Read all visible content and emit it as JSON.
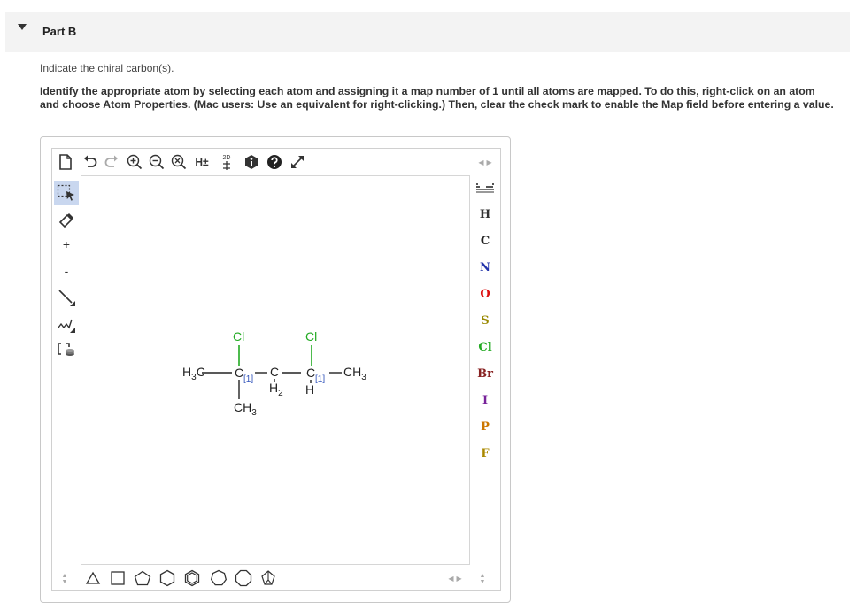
{
  "part": {
    "title": "Part B"
  },
  "question": {
    "prompt": "Indicate the chiral carbon(s).",
    "instructions": "Identify the appropriate atom by selecting each atom and assigning it a map number of 1 until all atoms are mapped. To do this, right-click on an atom and choose Atom Properties. (Mac users: Use an equivalent for right-clicking.) Then, clear the check mark to enable the Map field before entering a value."
  },
  "toolbar_top": {
    "hydrogen_toggle": "H±",
    "dimension_label": "2D"
  },
  "toolbar_left": {
    "charge_plus": "+",
    "charge_minus": "-"
  },
  "elements": [
    {
      "symbol": "H",
      "color": "#333333"
    },
    {
      "symbol": "C",
      "color": "#222222"
    },
    {
      "symbol": "N",
      "color": "#2233aa"
    },
    {
      "symbol": "O",
      "color": "#dd1111"
    },
    {
      "symbol": "S",
      "color": "#998800"
    },
    {
      "symbol": "Cl",
      "color": "#22aa22"
    },
    {
      "symbol": "Br",
      "color": "#882222"
    },
    {
      "symbol": "I",
      "color": "#772299"
    },
    {
      "symbol": "P",
      "color": "#cc7700"
    },
    {
      "symbol": "F",
      "color": "#aa8800"
    }
  ],
  "molecule": {
    "left_methyl": {
      "main": "H",
      "sub": "3",
      "tail": "C"
    },
    "c1": "C",
    "c1_map": "[1]",
    "c1_cl": "Cl",
    "c1_methyl": {
      "main": "CH",
      "sub": "3"
    },
    "c2": "C",
    "c2_h": {
      "main": "H",
      "sub": "2"
    },
    "c3": "C",
    "c3_map": "[1]",
    "c3_cl": "Cl",
    "c3_h": "H",
    "right_methyl": {
      "main": "CH",
      "sub": "3"
    }
  }
}
